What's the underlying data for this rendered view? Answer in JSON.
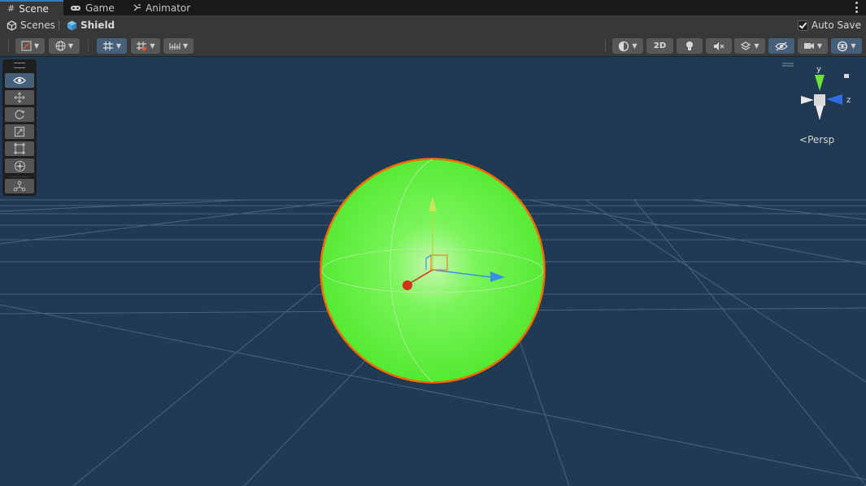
{
  "tabs": [
    {
      "label": "Scene",
      "icon": "grid-icon",
      "active": true
    },
    {
      "label": "Game",
      "icon": "gamepad-icon",
      "active": false
    },
    {
      "label": "Animator",
      "icon": "animator-icon",
      "active": false
    }
  ],
  "breadcrumb": {
    "root": "Scenes",
    "current": "Shield"
  },
  "autosave": {
    "label": "Auto Save",
    "checked": true
  },
  "toolbar": {
    "mode_2d": "2D"
  },
  "gizmo": {
    "y_label": "y",
    "z_label": "z",
    "projection": "Persp"
  },
  "tools": [
    {
      "name": "view-tool",
      "icon": "eye-icon",
      "active": true
    },
    {
      "name": "move-tool",
      "icon": "move-arrows-icon",
      "active": false
    },
    {
      "name": "rotate-tool",
      "icon": "rotate-icon",
      "active": false
    },
    {
      "name": "scale-tool",
      "icon": "scale-icon",
      "active": false
    },
    {
      "name": "rect-tool",
      "icon": "rect-transform-icon",
      "active": false
    },
    {
      "name": "transform-tool",
      "icon": "transform-icon",
      "active": false
    },
    {
      "name": "custom-tool",
      "icon": "custom-editor-tool-icon",
      "active": false
    }
  ],
  "colors": {
    "scene_background": "#213a53",
    "sphere": "#59f53a",
    "selection_outline": "#ff6a00",
    "axis_x": "#d4301c",
    "axis_y": "#a8e04a",
    "axis_z": "#3a8fe6",
    "accent": "#46607c"
  }
}
